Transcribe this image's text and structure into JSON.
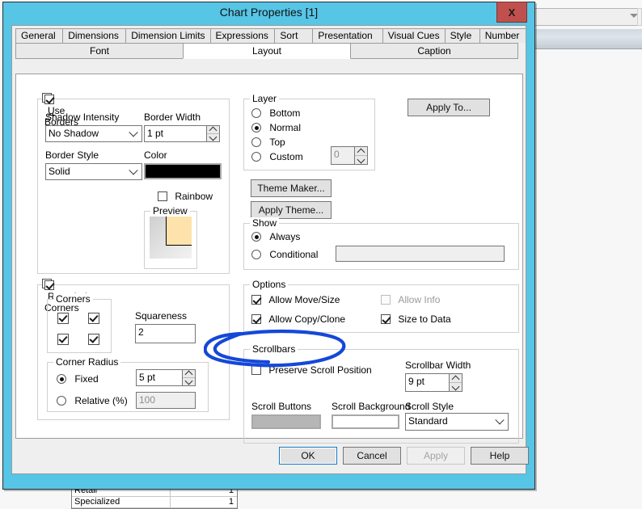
{
  "background": {
    "combo_value": "",
    "table": {
      "rows": [
        {
          "name": "Retail",
          "value": "1"
        },
        {
          "name": "Specialized",
          "value": "1"
        }
      ]
    }
  },
  "dialog": {
    "title": "Chart Properties [1]",
    "close_label": "X",
    "titlebar_color": "#56c5e6",
    "close_color": "#c0504d"
  },
  "tabs_row1": [
    {
      "label": "General"
    },
    {
      "label": "Dimensions"
    },
    {
      "label": "Dimension Limits"
    },
    {
      "label": "Expressions"
    },
    {
      "label": "Sort"
    },
    {
      "label": "Presentation"
    },
    {
      "label": "Visual Cues"
    },
    {
      "label": "Style"
    },
    {
      "label": "Number"
    }
  ],
  "tabs_row2": [
    {
      "label": "Font",
      "active": false
    },
    {
      "label": "Layout",
      "active": true
    },
    {
      "label": "Caption",
      "active": false
    }
  ],
  "use_borders": {
    "caption": "Use Borders",
    "checked": true,
    "shadow_intensity_label": "Shadow Intensity",
    "shadow_intensity_value": "No Shadow",
    "border_style_label": "Border Style",
    "border_style_value": "Solid",
    "border_width_label": "Border Width",
    "border_width_value": "1 pt",
    "color_label": "Color",
    "color_value": "#000000",
    "rainbow_label": "Rainbow",
    "rainbow_checked": false,
    "preview_label": "Preview"
  },
  "rounded_corners": {
    "caption": "Rounded Corners",
    "checked": true,
    "corners_label": "Corners",
    "corners_checked": [
      true,
      true,
      true,
      true
    ],
    "squareness_label": "Squareness",
    "squareness_value": "2",
    "corner_radius_label": "Corner Radius",
    "fixed_label": "Fixed",
    "fixed_selected": true,
    "fixed_value": "5 pt",
    "relative_label": "Relative (%)",
    "relative_selected": false,
    "relative_value": "100"
  },
  "layer": {
    "caption": "Layer",
    "options": [
      {
        "label": "Bottom",
        "selected": false
      },
      {
        "label": "Normal",
        "selected": true
      },
      {
        "label": "Top",
        "selected": false
      },
      {
        "label": "Custom",
        "selected": false
      }
    ],
    "custom_value": "0"
  },
  "buttons": {
    "apply_to": "Apply To...",
    "theme_maker": "Theme Maker...",
    "apply_theme": "Apply Theme..."
  },
  "show": {
    "caption": "Show",
    "always_label": "Always",
    "always_selected": true,
    "conditional_label": "Conditional",
    "conditional_selected": false,
    "conditional_value": ""
  },
  "options": {
    "caption": "Options",
    "allow_move_size": {
      "label": "Allow Move/Size",
      "checked": true,
      "enabled": true
    },
    "allow_info": {
      "label": "Allow Info",
      "checked": false,
      "enabled": false
    },
    "allow_copy_clone": {
      "label": "Allow Copy/Clone",
      "checked": true,
      "enabled": true
    },
    "size_to_data": {
      "label": "Size to Data",
      "checked": true,
      "enabled": true
    }
  },
  "scrollbars": {
    "caption": "Scrollbars",
    "preserve_scroll_position": {
      "label": "Preserve Scroll Position",
      "checked": false
    },
    "scrollbar_width_label": "Scrollbar Width",
    "scrollbar_width_value": "9 pt",
    "scroll_buttons_label": "Scroll Buttons",
    "scroll_buttons_color": "#b6b6b6",
    "scroll_background_label": "Scroll Background",
    "scroll_background_color": "#ffffff",
    "scroll_style_label": "Scroll Style",
    "scroll_style_value": "Standard"
  },
  "footer": {
    "ok": "OK",
    "cancel": "Cancel",
    "apply": "Apply",
    "help": "Help"
  },
  "annotation": {
    "shape": "ellipse-highlight",
    "color": "#1548d8",
    "targets": "Preserve Scroll Position"
  }
}
